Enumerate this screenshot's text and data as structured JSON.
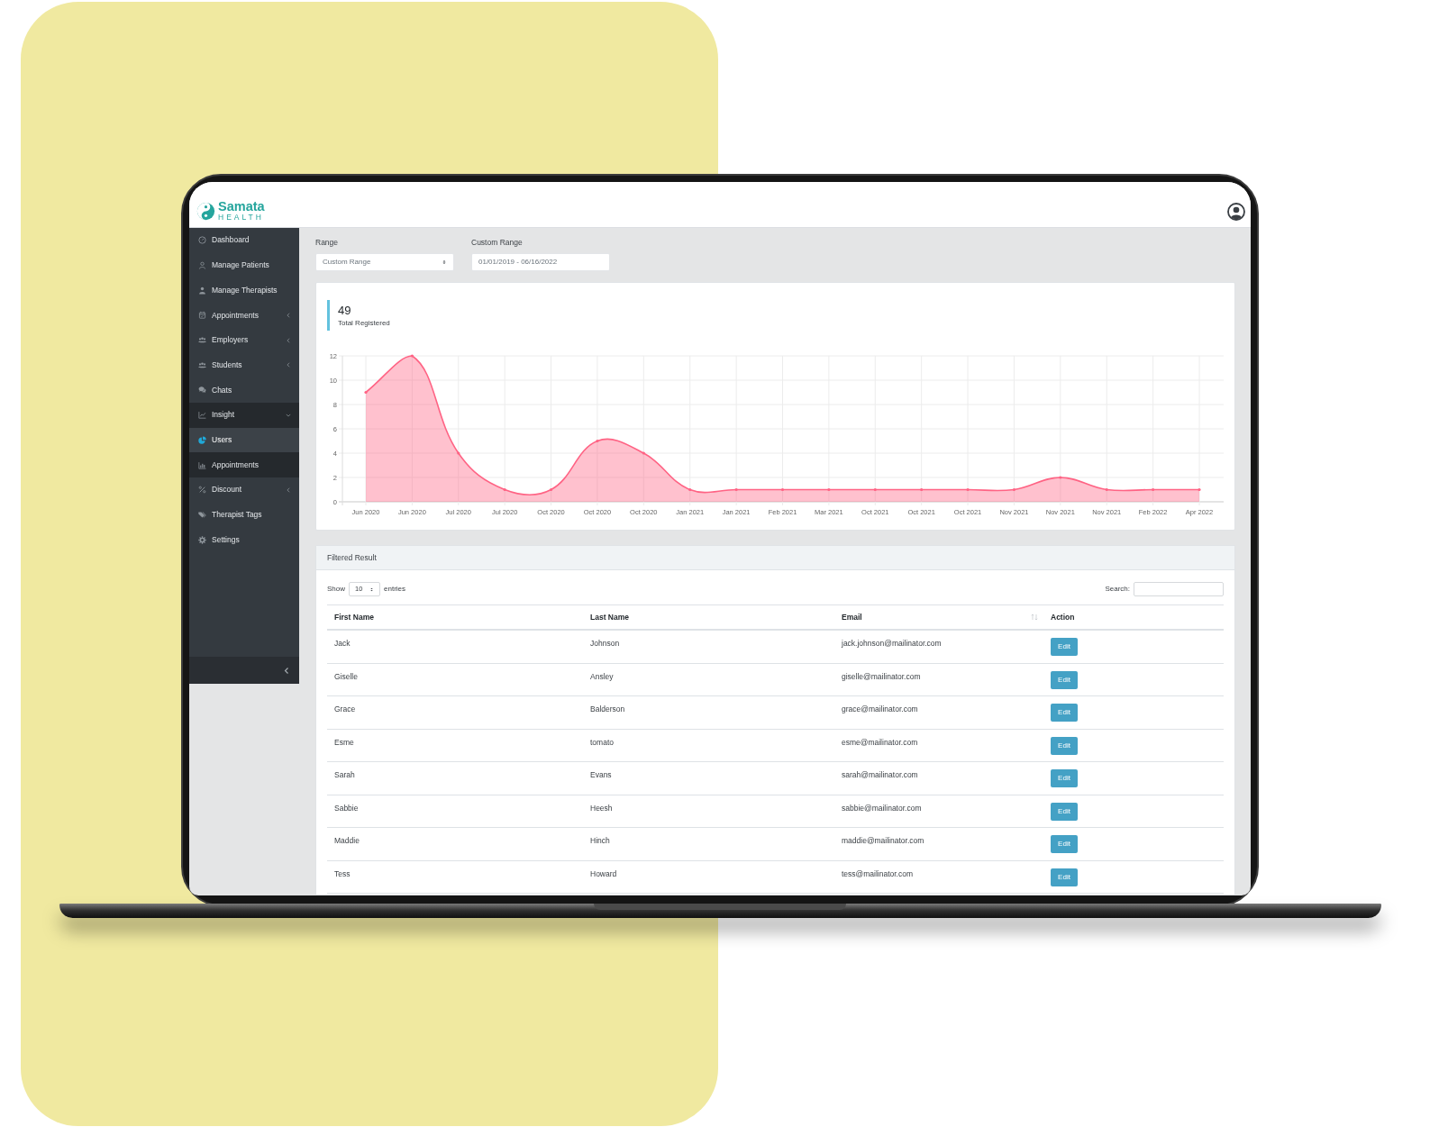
{
  "header": {
    "logo": {
      "name": "Samata",
      "tagline": "HEALTH"
    }
  },
  "sidebar": {
    "items": [
      {
        "label": "Dashboard",
        "selected": false
      },
      {
        "label": "Manage Patients",
        "selected": false
      },
      {
        "label": "Manage Therapists",
        "selected": false
      },
      {
        "label": "Appointments",
        "selected": false,
        "expanded": false
      },
      {
        "label": "Employers",
        "selected": false,
        "expanded": false
      },
      {
        "label": "Students",
        "selected": false,
        "expanded": false
      },
      {
        "label": "Chats",
        "selected": false
      },
      {
        "label": "Insight",
        "selected": false,
        "expanded": true,
        "children": [
          {
            "label": "Users",
            "selected": true
          },
          {
            "label": "Appointments",
            "selected": false
          }
        ]
      },
      {
        "label": "Discount",
        "selected": false,
        "expanded": false
      },
      {
        "label": "Therapist Tags",
        "selected": false
      },
      {
        "label": "Settings",
        "selected": false
      }
    ]
  },
  "filters": {
    "range": {
      "label": "Range",
      "value": "Custom Range"
    },
    "custom_range": {
      "label": "Custom Range",
      "value": "01/01/2019 - 06/16/2022"
    }
  },
  "summary": {
    "value": "49",
    "label": "Total Registered",
    "chart_data": {
      "type": "area",
      "grid": true,
      "categories": [
        "Jun 2020",
        "Jun 2020",
        "Jul 2020",
        "Jul 2020",
        "Oct 2020",
        "Oct 2020",
        "Oct 2020",
        "Jan 2021",
        "Jan 2021",
        "Feb 2021",
        "Mar 2021",
        "Oct 2021",
        "Oct 2021",
        "Oct 2021",
        "Nov 2021",
        "Nov 2021",
        "Nov 2021",
        "Feb 2022",
        "Apr 2022"
      ],
      "series": [
        {
          "color": "#ff6384",
          "values": [
            9,
            12,
            4,
            1,
            1,
            5,
            4,
            1,
            1,
            1,
            1,
            1,
            1,
            1,
            1,
            2,
            1,
            1,
            1
          ]
        }
      ],
      "ylim": [
        0,
        12
      ],
      "yticks": [
        0,
        2,
        4,
        6,
        8,
        10,
        12
      ]
    }
  },
  "results": {
    "title": "Filtered Result",
    "length_menu": {
      "label_before": "Show",
      "value": "10",
      "label_after": "entries"
    },
    "search": {
      "label": "Search:"
    },
    "columns": [
      {
        "label": "First Name",
        "sortable": false
      },
      {
        "label": "Last Name",
        "sortable": false
      },
      {
        "label": "Email",
        "sortable": true
      },
      {
        "label": "Action",
        "sortable": false
      }
    ],
    "rows": [
      {
        "first_name": "Jack",
        "last_name": "Johnson",
        "email": "jack.johnson@mailinator.com",
        "action": "Edit"
      },
      {
        "first_name": "Giselle",
        "last_name": "Ansley",
        "email": "giselle@mailinator.com",
        "action": "Edit"
      },
      {
        "first_name": "Grace",
        "last_name": "Balderson",
        "email": "grace@mailinator.com",
        "action": "Edit"
      },
      {
        "first_name": "Esme",
        "last_name": "tomato",
        "email": "esme@mailinator.com",
        "action": "Edit"
      },
      {
        "first_name": "Sarah",
        "last_name": "Evans",
        "email": "sarah@mailinator.com",
        "action": "Edit"
      },
      {
        "first_name": "Sabbie",
        "last_name": "Heesh",
        "email": "sabbie@mailinator.com",
        "action": "Edit"
      },
      {
        "first_name": "Maddie",
        "last_name": "Hinch",
        "email": "maddie@mailinator.com",
        "action": "Edit"
      },
      {
        "first_name": "Tess",
        "last_name": "Howard",
        "email": "tess@mailinator.com",
        "action": "Edit"
      }
    ]
  }
}
